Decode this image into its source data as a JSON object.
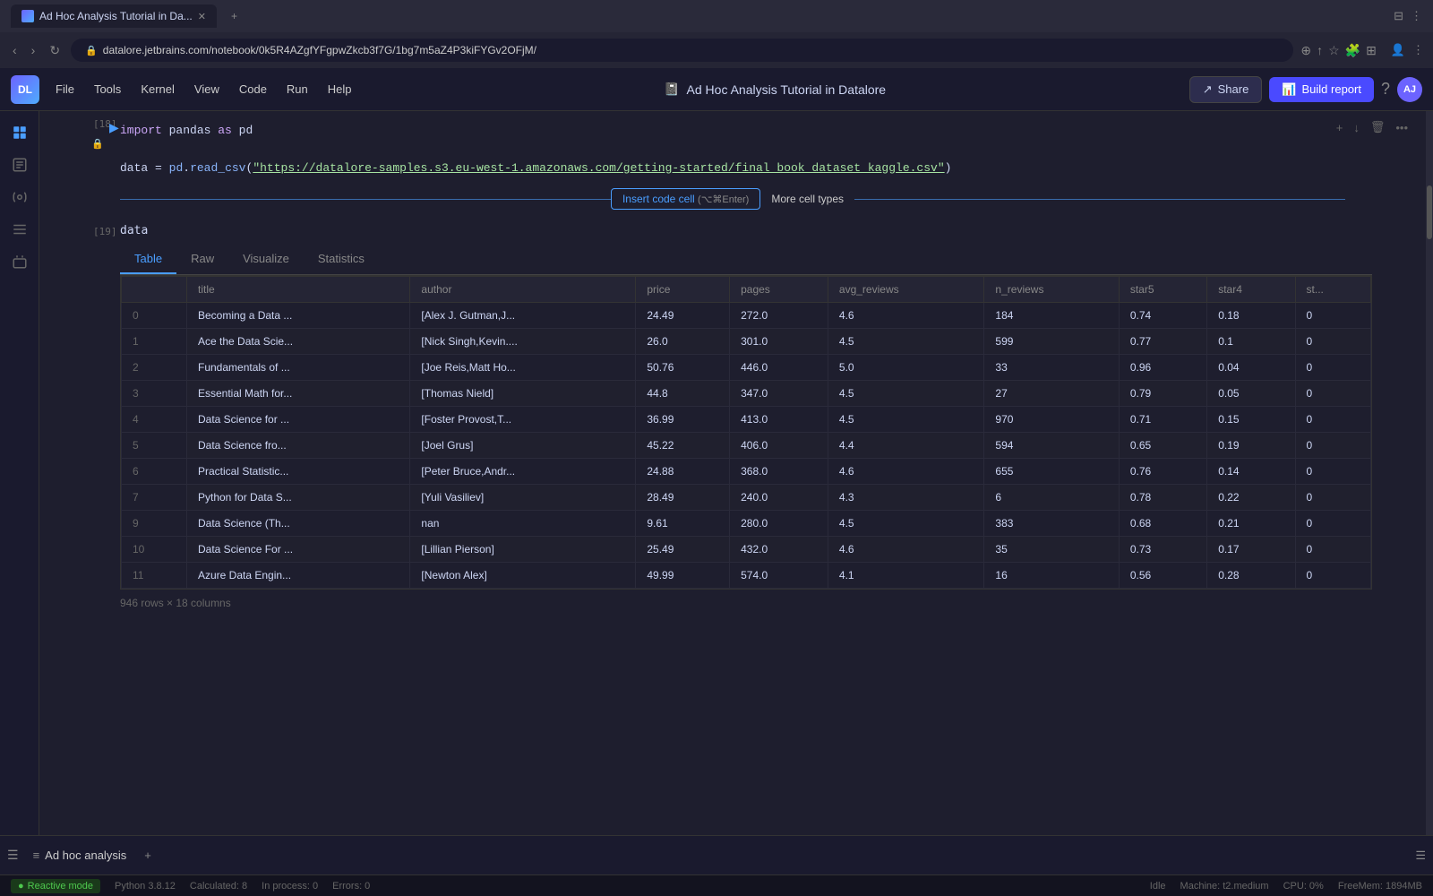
{
  "browser": {
    "tab_title": "Ad Hoc Analysis Tutorial in Da...",
    "url": "datalore.jetbrains.com/notebook/0k5R4AZgfYFgpwZkcb3f7G/1bg7m5aZ4P3kiFYGv2OFjM/",
    "new_tab_label": "+"
  },
  "header": {
    "logo_text": "DL",
    "menu_items": [
      "File",
      "Tools",
      "Kernel",
      "View",
      "Code",
      "Run",
      "Help"
    ],
    "title": "Ad Hoc Analysis Tutorial in Datalore",
    "share_label": "Share",
    "build_report_label": "Build report"
  },
  "cell18": {
    "number": "[18]",
    "code_lines": [
      "import pandas as pd",
      "",
      "data = pd.read_csv(\"https://datalore-samples.s3.eu-west-1.amazonaws.com/getting-started/final_book_dataset_kaggle.csv\")"
    ]
  },
  "insert_bar": {
    "label": "Insert code cell",
    "shortcut": "(⌥⌘Enter)",
    "more_types": "More cell types"
  },
  "cell19": {
    "number": "[19]",
    "variable": "data"
  },
  "output_tabs": [
    "Table",
    "Raw",
    "Visualize",
    "Statistics"
  ],
  "table": {
    "columns": [
      "",
      "title",
      "author",
      "price",
      "pages",
      "avg_reviews",
      "n_reviews",
      "star5",
      "star4",
      "st..."
    ],
    "rows": [
      [
        "0",
        "Becoming a Data ...",
        "[Alex J. Gutman,J...",
        "24.49",
        "272.0",
        "4.6",
        "184",
        "0.74",
        "0.18",
        "0"
      ],
      [
        "1",
        "Ace the Data Scie...",
        "[Nick Singh,Kevin....",
        "26.0",
        "301.0",
        "4.5",
        "599",
        "0.77",
        "0.1",
        "0"
      ],
      [
        "2",
        "Fundamentals of ...",
        "[Joe Reis,Matt Ho...",
        "50.76",
        "446.0",
        "5.0",
        "33",
        "0.96",
        "0.04",
        "0"
      ],
      [
        "3",
        "Essential Math for...",
        "[Thomas Nield]",
        "44.8",
        "347.0",
        "4.5",
        "27",
        "0.79",
        "0.05",
        "0"
      ],
      [
        "4",
        "Data Science for ...",
        "[Foster Provost,T...",
        "36.99",
        "413.0",
        "4.5",
        "970",
        "0.71",
        "0.15",
        "0"
      ],
      [
        "5",
        "Data Science fro...",
        "[Joel Grus]",
        "45.22",
        "406.0",
        "4.4",
        "594",
        "0.65",
        "0.19",
        "0"
      ],
      [
        "6",
        "Practical Statistic...",
        "[Peter Bruce,Andr...",
        "24.88",
        "368.0",
        "4.6",
        "655",
        "0.76",
        "0.14",
        "0"
      ],
      [
        "7",
        "Python for Data S...",
        "[Yuli Vasiliev]",
        "28.49",
        "240.0",
        "4.3",
        "6",
        "0.78",
        "0.22",
        "0"
      ],
      [
        "9",
        "Data Science (Th...",
        "nan",
        "9.61",
        "280.0",
        "4.5",
        "383",
        "0.68",
        "0.21",
        "0"
      ],
      [
        "10",
        "Data Science For ...",
        "[Lillian Pierson]",
        "25.49",
        "432.0",
        "4.6",
        "35",
        "0.73",
        "0.17",
        "0"
      ],
      [
        "11",
        "Azure Data Engin...",
        "[Newton Alex]",
        "49.99",
        "574.0",
        "4.1",
        "16",
        "0.56",
        "0.28",
        "0"
      ]
    ],
    "footer": "946 rows × 18 columns"
  },
  "bottom_tab": {
    "label": "Ad hoc analysis",
    "add_label": "+"
  },
  "status_bar": {
    "reactive_mode": "Reactive mode",
    "python_version": "Python 3.8.12",
    "calculated": "Calculated: 8",
    "in_process": "In process: 0",
    "errors": "Errors: 0",
    "idle": "Idle",
    "machine": "Machine: t2.medium",
    "cpu": "CPU: 0%",
    "free_mem": "FreeMem: 1894MB"
  },
  "icons": {
    "sidebar": [
      "layers-icon",
      "note-icon",
      "plugin-icon",
      "list-icon",
      "variable-icon"
    ],
    "toolbar": [
      "add-icon",
      "insert-down-icon",
      "delete-icon",
      "more-icon"
    ]
  }
}
